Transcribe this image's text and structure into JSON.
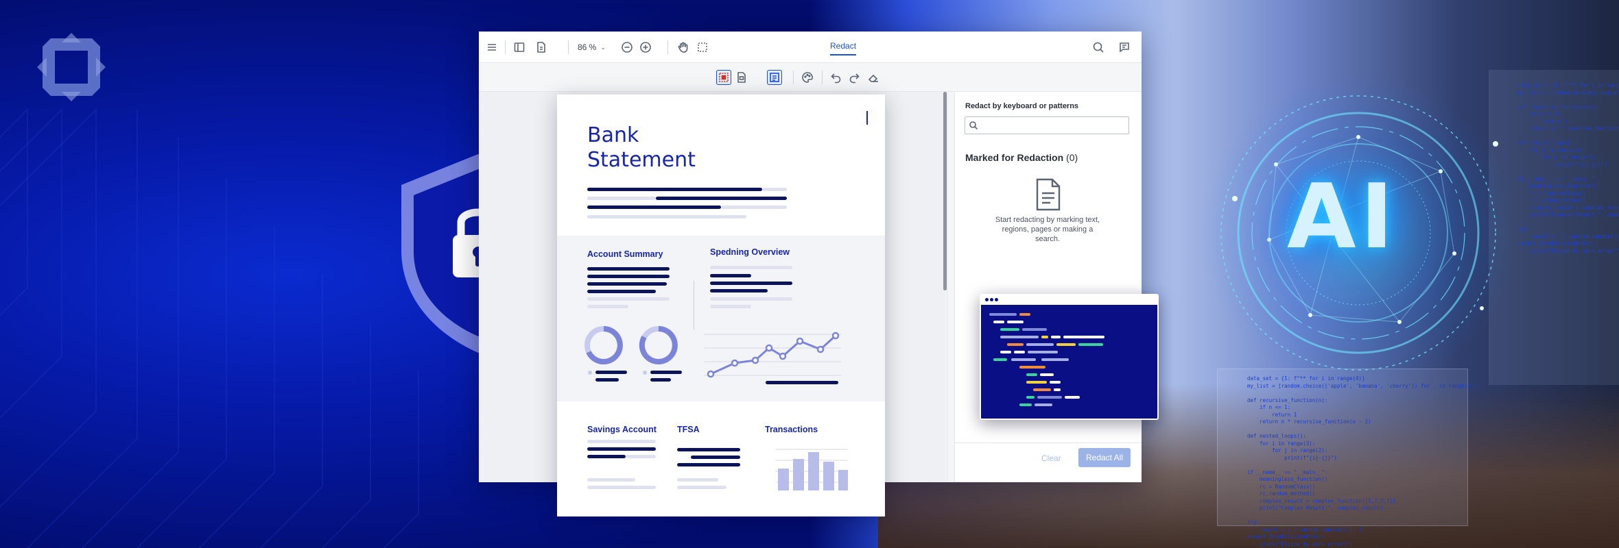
{
  "toolbar": {
    "zoom": "86 %",
    "tab_active": "Redact",
    "icons": [
      "menu-icon",
      "sidebar-icon",
      "document-icon",
      "zoom-out-icon",
      "zoom-in-icon",
      "pan-hand-icon",
      "marquee-select-icon",
      "search-icon",
      "comments-icon"
    ]
  },
  "subtoolbar": {
    "icons": [
      "redact-area-icon",
      "redact-page-icon",
      "redact-text-icon",
      "color-palette-icon",
      "undo-icon",
      "redo-icon",
      "eraser-icon"
    ]
  },
  "document": {
    "title": "Bank\nStatement",
    "sections": {
      "account_summary": "Account Summary",
      "spending_overview": "Spedning Overview",
      "savings_account": "Savings Account",
      "tfsa": "TFSA",
      "transactions": "Transactions"
    }
  },
  "redaction_panel": {
    "search_title": "Redact by keyboard or patterns",
    "search_placeholder": "",
    "marked_label": "Marked for Redaction",
    "marked_count": "(0)",
    "empty_message": "Start redacting by marking text, regions, pages or making a search.",
    "clear_label": "Clear",
    "redact_all_label": "Redact All"
  },
  "art": {
    "ai_label": "AI",
    "accent": "#1725a8",
    "button_color": "#9bb3e6"
  }
}
